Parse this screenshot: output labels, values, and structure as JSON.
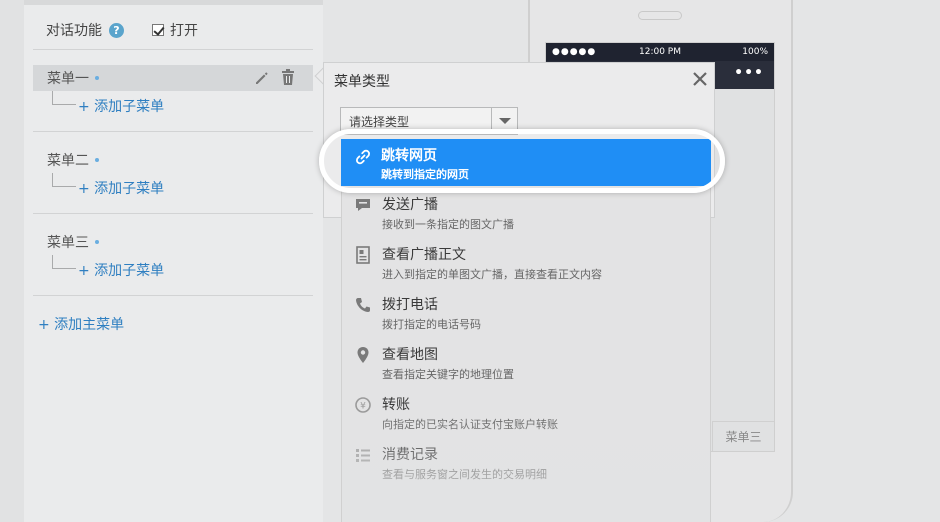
{
  "dialog": {
    "label": "对话功能",
    "help": "?",
    "toggle_label": "打开"
  },
  "menus": [
    {
      "name": "菜单一",
      "add_sub": "+ 添加子菜单"
    },
    {
      "name": "菜单二",
      "add_sub": "+ 添加子菜单"
    },
    {
      "name": "菜单三",
      "add_sub": "+ 添加子菜单"
    }
  ],
  "add_main": "+ 添加主菜单",
  "type_panel": {
    "title": "菜单类型",
    "select_placeholder": "请选择类型"
  },
  "options": [
    {
      "title": "跳转网页",
      "desc": "跳转到指定的网页",
      "icon": "link-icon"
    },
    {
      "title": "发送广播",
      "desc": "接收到一条指定的图文广播",
      "icon": "message-icon"
    },
    {
      "title": "查看广播正文",
      "desc": "进入到指定的单图文广播，直接查看正文内容",
      "icon": "document-icon"
    },
    {
      "title": "拨打电话",
      "desc": "拨打指定的电话号码",
      "icon": "phone-icon"
    },
    {
      "title": "查看地图",
      "desc": "查看指定关键字的地理位置",
      "icon": "location-icon"
    },
    {
      "title": "转账",
      "desc": "向指定的已实名认证支付宝账户转账",
      "icon": "transfer-icon"
    },
    {
      "title": "消费记录",
      "desc": "查看与服务窗之间发生的交易明细",
      "icon": "list-icon"
    }
  ],
  "phone": {
    "signal": "●●●●●",
    "time": "12:00 PM",
    "battery": "100%",
    "more": "•••",
    "menu_tab": "菜单三"
  },
  "colors": {
    "highlight": "#1f8ef5",
    "link": "#2f7fc1",
    "dot": "#6aaee0"
  }
}
